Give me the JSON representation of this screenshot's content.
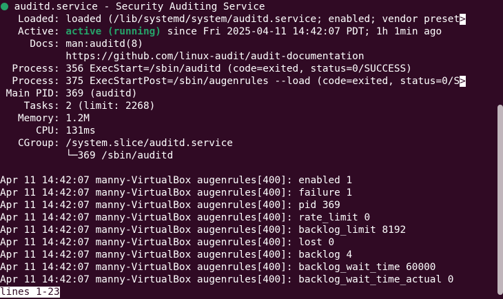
{
  "header": {
    "unit": "auditd.service - Security Auditing Service"
  },
  "status": [
    {
      "key": "   Loaded: ",
      "value": "loaded (/lib/systemd/system/auditd.service; enabled; vendor preset"
    },
    {
      "key": "   Active: ",
      "active": "active (running)",
      "value": " since Fri 2025-04-11 14:42:07 PDT; 1h 1min ago"
    },
    {
      "key": "     Docs: ",
      "value": "man:auditd(8)"
    },
    {
      "key": "           ",
      "value": "https://github.com/linux-audit/audit-documentation"
    },
    {
      "key": "  Process: ",
      "value": "356 ExecStart=/sbin/auditd (code=exited, status=0/SUCCESS)"
    },
    {
      "key": "  Process: ",
      "value": "375 ExecStartPost=/sbin/augenrules --load (code=exited, status=0/S"
    },
    {
      "key": " Main PID: ",
      "value": "369 (auditd)"
    },
    {
      "key": "    Tasks: ",
      "value": "2 (limit: 2268)"
    },
    {
      "key": "   Memory: ",
      "value": "1.2M"
    },
    {
      "key": "      CPU: ",
      "value": "131ms"
    },
    {
      "key": "   CGroup: ",
      "value": "/system.slice/auditd.service"
    },
    {
      "key": "           ",
      "value": "└─369 /sbin/auditd"
    }
  ],
  "truncation_marker": ">",
  "log": [
    "Apr 11 14:42:07 manny-VirtualBox augenrules[400]: enabled 1",
    "Apr 11 14:42:07 manny-VirtualBox augenrules[400]: failure 1",
    "Apr 11 14:42:07 manny-VirtualBox augenrules[400]: pid 369",
    "Apr 11 14:42:07 manny-VirtualBox augenrules[400]: rate_limit 0",
    "Apr 11 14:42:07 manny-VirtualBox augenrules[400]: backlog_limit 8192",
    "Apr 11 14:42:07 manny-VirtualBox augenrules[400]: lost 0",
    "Apr 11 14:42:07 manny-VirtualBox augenrules[400]: backlog 4",
    "Apr 11 14:42:07 manny-VirtualBox augenrules[400]: backlog_wait_time 60000",
    "Apr 11 14:42:07 manny-VirtualBox augenrules[400]: backlog_wait_time_actual 0"
  ],
  "pager": {
    "status": "lines 1-23"
  },
  "colors": {
    "background": "#300a24",
    "foreground": "#ffffff",
    "active_green": "#26a269"
  }
}
